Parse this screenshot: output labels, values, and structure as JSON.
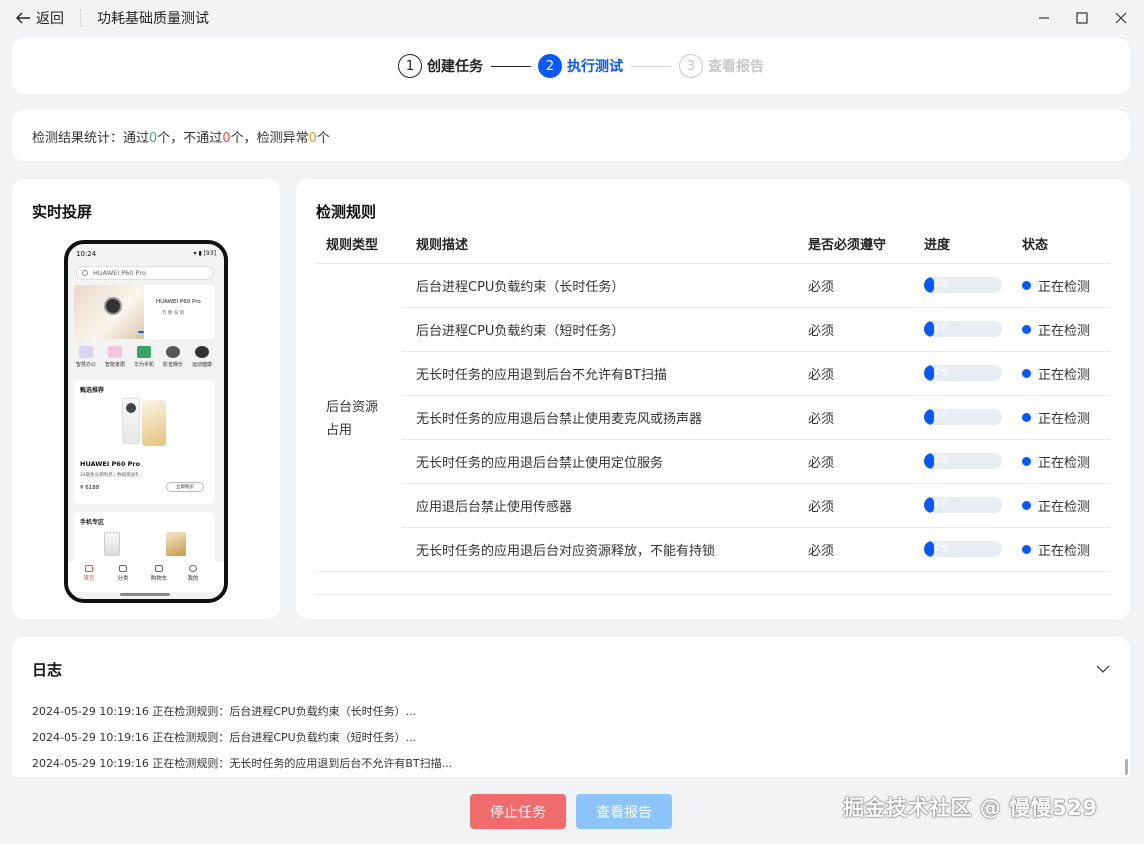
{
  "titlebar": {
    "back_label": "返回",
    "title": "功耗基础质量测试"
  },
  "stepper": {
    "steps": [
      {
        "num": "1",
        "label": "创建任务"
      },
      {
        "num": "2",
        "label": "执行测试"
      },
      {
        "num": "3",
        "label": "查看报告"
      }
    ],
    "active_color": "#0a59f7",
    "inactive_color": "#c8c8c8"
  },
  "stats": {
    "prefix": "检测结果统计：通过",
    "pass_count": "0",
    "pass_suffix": "个，不通过",
    "fail_count": "0",
    "fail_suffix": "个，检测异常",
    "error_count": "0",
    "error_suffix": "个",
    "pass_color": "#3cb371",
    "fail_color": "#e84a4a",
    "error_color": "#f29b1e"
  },
  "screen": {
    "title": "实时投屏",
    "phone": {
      "time": "10:24",
      "status_right": "▾ ▮ [93]",
      "search": "HUAWEI P60 Pro",
      "banner_title": "HUAWEI P60 Pro",
      "banner_sub": "万 象 归 新",
      "categories": [
        "智慧办公",
        "智能家居",
        "华为手机",
        "影音娱乐",
        "运动健康"
      ],
      "card1_title": "甄选推荐",
      "product_name": "HUAWEI P60 Pro",
      "product_desc": "24期免分期利息 | 数据赠送礼",
      "price": "¥ 6188",
      "buy": "立即购买",
      "card2_title": "手机专区",
      "nav": [
        "首页",
        "分类",
        "购物车",
        "我的"
      ]
    }
  },
  "rules": {
    "title": "检测规则",
    "headers": [
      "规则类型",
      "规则描述",
      "是否必须遵守",
      "进度",
      "状态"
    ],
    "group": "后台资源占用",
    "group_line1": "后台资源",
    "group_line2": "占用",
    "progress_color": "#0a59f7",
    "items": [
      {
        "desc": "后台进程CPU负载约束（长时任务）",
        "required": "必须",
        "progress": 0.12,
        "progress_label": "1%",
        "status": "正在检测"
      },
      {
        "desc": "后台进程CPU负载约束（短时任务）",
        "required": "必须",
        "progress": 0.12,
        "progress_label": "1%",
        "status": "正在检测"
      },
      {
        "desc": "无长时任务的应用退到后台不允许有BT扫描",
        "required": "必须",
        "progress": 0.12,
        "progress_label": "1%",
        "status": "正在检测"
      },
      {
        "desc": "无长时任务的应用退后台禁止使用麦克风或扬声器",
        "required": "必须",
        "progress": 0.12,
        "progress_label": "1%",
        "status": "正在检测"
      },
      {
        "desc": "无长时任务的应用退后台禁止使用定位服务",
        "required": "必须",
        "progress": 0.12,
        "progress_label": "1%",
        "status": "正在检测"
      },
      {
        "desc": "应用退后台禁止使用传感器",
        "required": "必须",
        "progress": 0.12,
        "progress_label": "1%",
        "status": "正在检测"
      },
      {
        "desc": "无长时任务的应用退后台对应资源释放，不能有持锁",
        "required": "必须",
        "progress": 0.12,
        "progress_label": "1%",
        "status": "正在检测"
      }
    ]
  },
  "log": {
    "title": "日志",
    "lines": [
      "2024-05-29 10:19:16 正在检测规则：后台进程CPU负载约束（长时任务）...",
      "2024-05-29 10:19:16 正在检测规则：后台进程CPU负载约束（短时任务）...",
      "2024-05-29 10:19:16 正在检测规则：无长时任务的应用退到后台不允许有BT扫描..."
    ]
  },
  "actions": {
    "stop_label": "停止任务",
    "report_label": "查看报告"
  },
  "watermark": "掘金技术社区 @ 慢慢529"
}
